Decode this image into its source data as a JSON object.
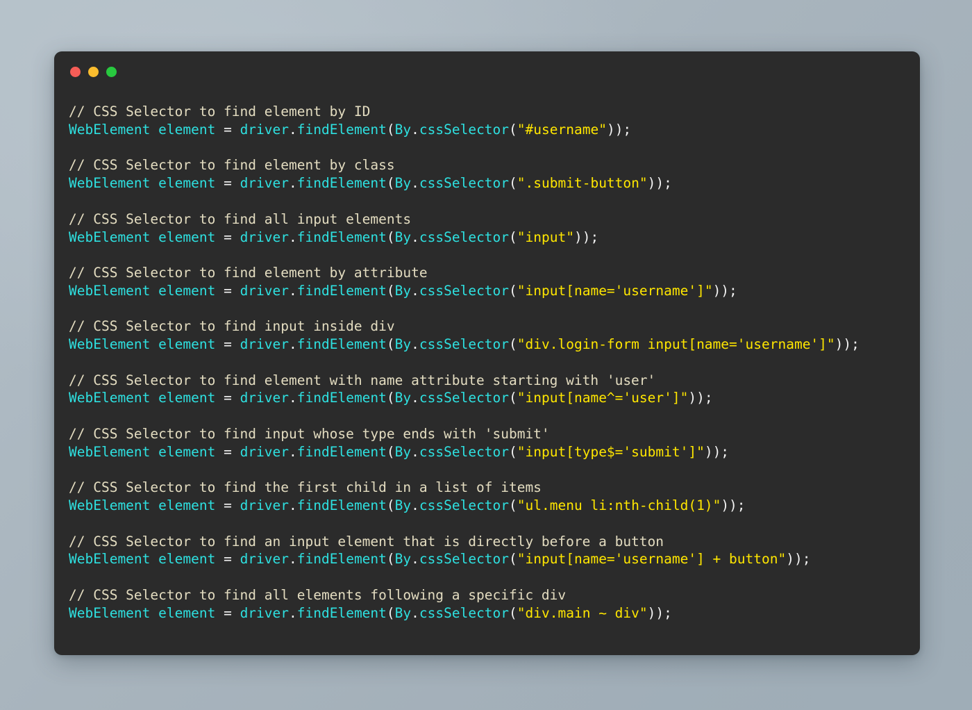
{
  "window": {
    "background_color": "#2b2b2b",
    "traffic_lights": [
      {
        "name": "close",
        "color": "#f65d57"
      },
      {
        "name": "minimize",
        "color": "#fbbd2e"
      },
      {
        "name": "maximize",
        "color": "#28c93f"
      }
    ]
  },
  "theme": {
    "page_background": "#aab6bf",
    "comment_color": "#e3dcc0",
    "identifier_color": "#2ee0e0",
    "punctuation_color": "#f4f4f4",
    "string_color": "#ffe600"
  },
  "code": {
    "language": "java",
    "blocks": [
      {
        "comment": "// CSS Selector to find element by ID",
        "decl": "WebElement element",
        "eq": " = ",
        "call_head": "driver",
        "dot1": ".",
        "method": "findElement",
        "open1": "(",
        "by": "By",
        "dot2": ".",
        "by_method": "cssSelector",
        "open2": "(",
        "quote_open": "\"",
        "selector": "#username",
        "quote_close": "\"",
        "close": "));"
      },
      {
        "comment": "// CSS Selector to find element by class",
        "decl": "WebElement element",
        "eq": " = ",
        "call_head": "driver",
        "dot1": ".",
        "method": "findElement",
        "open1": "(",
        "by": "By",
        "dot2": ".",
        "by_method": "cssSelector",
        "open2": "(",
        "quote_open": "\"",
        "selector": ".submit-button",
        "quote_close": "\"",
        "close": "));"
      },
      {
        "comment": "// CSS Selector to find all input elements",
        "decl": "WebElement element",
        "eq": " = ",
        "call_head": "driver",
        "dot1": ".",
        "method": "findElement",
        "open1": "(",
        "by": "By",
        "dot2": ".",
        "by_method": "cssSelector",
        "open2": "(",
        "quote_open": "\"",
        "selector": "input",
        "quote_close": "\"",
        "close": "));"
      },
      {
        "comment": "// CSS Selector to find element by attribute",
        "decl": "WebElement element",
        "eq": " = ",
        "call_head": "driver",
        "dot1": ".",
        "method": "findElement",
        "open1": "(",
        "by": "By",
        "dot2": ".",
        "by_method": "cssSelector",
        "open2": "(",
        "quote_open": "\"",
        "selector": "input[name='username']",
        "quote_close": "\"",
        "close": "));"
      },
      {
        "comment": "// CSS Selector to find input inside div",
        "decl": "WebElement element",
        "eq": " = ",
        "call_head": "driver",
        "dot1": ".",
        "method": "findElement",
        "open1": "(",
        "by": "By",
        "dot2": ".",
        "by_method": "cssSelector",
        "open2": "(",
        "quote_open": "\"",
        "selector": "div.login-form input[name='username']",
        "quote_close": "\"",
        "close": "));"
      },
      {
        "comment": "// CSS Selector to find element with name attribute starting with 'user'",
        "decl": "WebElement element",
        "eq": " = ",
        "call_head": "driver",
        "dot1": ".",
        "method": "findElement",
        "open1": "(",
        "by": "By",
        "dot2": ".",
        "by_method": "cssSelector",
        "open2": "(",
        "quote_open": "\"",
        "selector": "input[name^='user']",
        "quote_close": "\"",
        "close": "));"
      },
      {
        "comment": "// CSS Selector to find input whose type ends with 'submit'",
        "decl": "WebElement element",
        "eq": " = ",
        "call_head": "driver",
        "dot1": ".",
        "method": "findElement",
        "open1": "(",
        "by": "By",
        "dot2": ".",
        "by_method": "cssSelector",
        "open2": "(",
        "quote_open": "\"",
        "selector": "input[type$='submit']",
        "quote_close": "\"",
        "close": "));"
      },
      {
        "comment": "// CSS Selector to find the first child in a list of items",
        "decl": "WebElement element",
        "eq": " = ",
        "call_head": "driver",
        "dot1": ".",
        "method": "findElement",
        "open1": "(",
        "by": "By",
        "dot2": ".",
        "by_method": "cssSelector",
        "open2": "(",
        "quote_open": "\"",
        "selector": "ul.menu li:nth-child(1)",
        "quote_close": "\"",
        "close": "));"
      },
      {
        "comment": "// CSS Selector to find an input element that is directly before a button",
        "decl": "WebElement element",
        "eq": " = ",
        "call_head": "driver",
        "dot1": ".",
        "method": "findElement",
        "open1": "(",
        "by": "By",
        "dot2": ".",
        "by_method": "cssSelector",
        "open2": "(",
        "quote_open": "\"",
        "selector": "input[name='username'] + button",
        "quote_close": "\"",
        "close": "));"
      },
      {
        "comment": "// CSS Selector to find all elements following a specific div",
        "decl": "WebElement element",
        "eq": " = ",
        "call_head": "driver",
        "dot1": ".",
        "method": "findElement",
        "open1": "(",
        "by": "By",
        "dot2": ".",
        "by_method": "cssSelector",
        "open2": "(",
        "quote_open": "\"",
        "selector": "div.main ~ div",
        "quote_close": "\"",
        "close": "));"
      }
    ]
  }
}
